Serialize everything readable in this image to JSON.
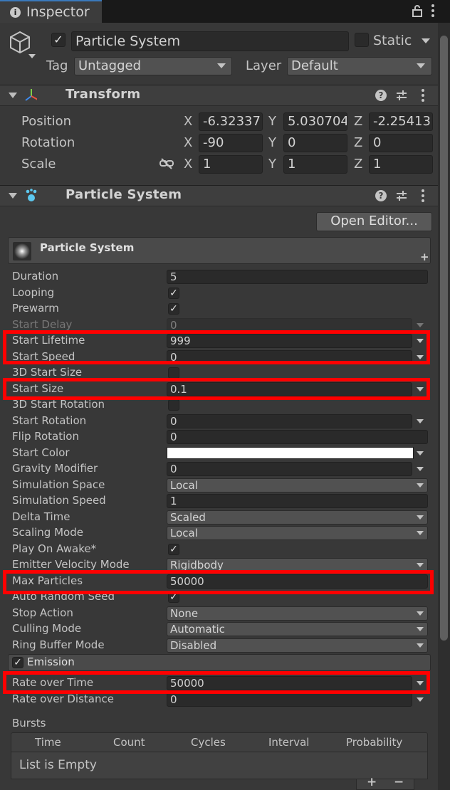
{
  "tab": {
    "title": "Inspector",
    "icon": "info-icon"
  },
  "object": {
    "active": true,
    "name": "Particle System",
    "static_label": "Static",
    "static": false,
    "tag_label": "Tag",
    "tag": "Untagged",
    "layer_label": "Layer",
    "layer": "Default"
  },
  "transform": {
    "title": "Transform",
    "rows": [
      {
        "label": "Position",
        "x": "-6.32337",
        "y": "5.030704",
        "z": "-2.25413"
      },
      {
        "label": "Rotation",
        "x": "-90",
        "y": "0",
        "z": "0"
      },
      {
        "label": "Scale",
        "x": "1",
        "y": "1",
        "z": "1"
      }
    ],
    "axes": {
      "x": "X",
      "y": "Y",
      "z": "Z"
    }
  },
  "particle_component": {
    "title": "Particle System",
    "open_editor": "Open Editor..."
  },
  "main_module": {
    "title": "Particle System",
    "rows": [
      {
        "label": "Duration",
        "kind": "field",
        "value": "5"
      },
      {
        "label": "Looping",
        "kind": "check",
        "value": "✓"
      },
      {
        "label": "Prewarm",
        "kind": "check",
        "value": "✓"
      },
      {
        "label": "Start Delay",
        "kind": "fieldmenu",
        "value": "0",
        "disabled": true
      },
      {
        "label": "Start Lifetime",
        "kind": "fieldmenu",
        "value": "999"
      },
      {
        "label": "Start Speed",
        "kind": "fieldmenu",
        "value": "0"
      },
      {
        "label": "3D Start Size",
        "kind": "check",
        "value": ""
      },
      {
        "label": "Start Size",
        "kind": "fieldmenu",
        "value": "0.1"
      },
      {
        "label": "3D Start Rotation",
        "kind": "check",
        "value": ""
      },
      {
        "label": "Start Rotation",
        "kind": "fieldmenu",
        "value": "0"
      },
      {
        "label": "Flip Rotation",
        "kind": "field",
        "value": "0"
      },
      {
        "label": "Start Color",
        "kind": "color",
        "value": ""
      },
      {
        "label": "Gravity Modifier",
        "kind": "fieldmenu",
        "value": "0"
      },
      {
        "label": "Simulation Space",
        "kind": "dropdown",
        "value": "Local"
      },
      {
        "label": "Simulation Speed",
        "kind": "field",
        "value": "1"
      },
      {
        "label": "Delta Time",
        "kind": "dropdown",
        "value": "Scaled"
      },
      {
        "label": "Scaling Mode",
        "kind": "dropdown",
        "value": "Local"
      },
      {
        "label": "Play On Awake*",
        "kind": "check",
        "value": "✓"
      },
      {
        "label": "Emitter Velocity Mode",
        "kind": "dropdown",
        "value": "Rigidbody"
      },
      {
        "label": "Max Particles",
        "kind": "field",
        "value": "50000"
      },
      {
        "label": "Auto Random Seed",
        "kind": "check",
        "value": "✓"
      },
      {
        "label": "Stop Action",
        "kind": "dropdown",
        "value": "None"
      },
      {
        "label": "Culling Mode",
        "kind": "dropdown",
        "value": "Automatic"
      },
      {
        "label": "Ring Buffer Mode",
        "kind": "dropdown",
        "value": "Disabled"
      }
    ]
  },
  "emission": {
    "title": "Emission",
    "enabled": true,
    "rate_over_time_label": "Rate over Time",
    "rate_over_time": "50000",
    "rate_over_distance_label": "Rate over Distance",
    "rate_over_distance": "0",
    "bursts_label": "Bursts",
    "burst_columns": [
      "Time",
      "Count",
      "Cycles",
      "Interval",
      "Probability"
    ],
    "bursts_empty": "List is Empty",
    "add": "+",
    "remove": "−"
  },
  "colors": {
    "highlight": "#ff0000",
    "background": "#383838",
    "field": "#2a2a2a"
  }
}
